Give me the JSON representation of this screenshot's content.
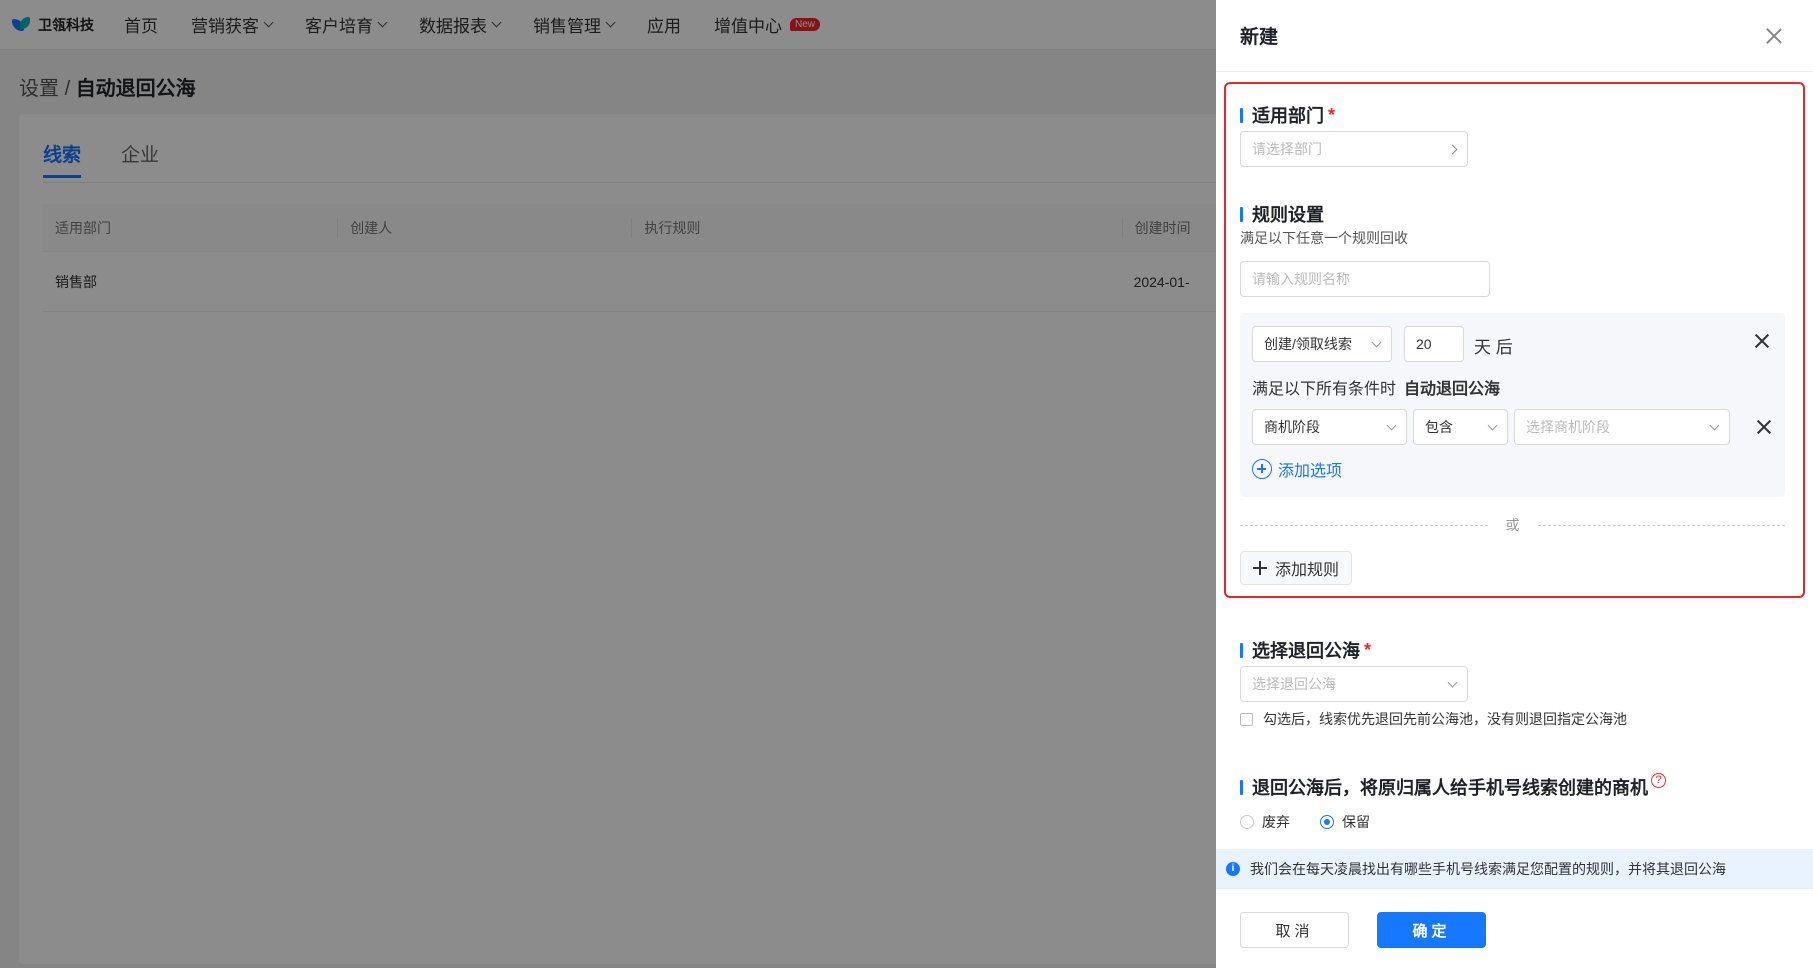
{
  "nav": {
    "logo": "卫瓴科技",
    "items": [
      {
        "label": "首页",
        "dropdown": false
      },
      {
        "label": "营销获客",
        "dropdown": true
      },
      {
        "label": "客户培育",
        "dropdown": true
      },
      {
        "label": "数据报表",
        "dropdown": true
      },
      {
        "label": "销售管理",
        "dropdown": true
      },
      {
        "label": "应用",
        "dropdown": false
      },
      {
        "label": "增值中心",
        "dropdown": false
      }
    ],
    "new_badge": "New"
  },
  "breadcrumb": {
    "parent": "设置",
    "sep": "/",
    "current": "自动退回公海"
  },
  "tabs": [
    "线索",
    "企业"
  ],
  "table": {
    "headers": [
      "适用部门",
      "创建人",
      "执行规则",
      "创建时间"
    ],
    "rows": [
      {
        "dept": "销售部",
        "creator": "",
        "rule": "",
        "time": "2024-01-"
      }
    ]
  },
  "drawer": {
    "title": "新建",
    "dept_section": {
      "title": "适用部门",
      "required": "*",
      "placeholder": "请选择部门"
    },
    "rule_section": {
      "title": "规则设置",
      "desc": "满足以下任意一个规则回收",
      "name_placeholder": "请输入规则名称",
      "trigger_select": "创建/领取线索",
      "days_value": "20",
      "days_unit": "天 后",
      "condition_prefix": "满足以下所有条件时",
      "condition_action": "自动退回公海",
      "field_select": "商机阶段",
      "operator_select": "包含",
      "value_placeholder": "选择商机阶段",
      "add_option": "添加选项",
      "or_text": "或",
      "add_rule": "添加规则"
    },
    "pool_section": {
      "title": "选择退回公海",
      "required": "*",
      "placeholder": "选择退回公海",
      "checkbox_label": "勾选后，线索优先退回先前公海池，没有则退回指定公海池"
    },
    "opportunity_section": {
      "title": "退回公海后，将原归属人给手机号线索创建的商机",
      "help": "?",
      "options": [
        "废弃",
        "保留"
      ],
      "selected": "保留"
    },
    "info": "我们会在每天凌晨找出有哪些手机号线索满足您配置的规则，并将其退回公海",
    "info_icon": "i",
    "cancel": "取消",
    "confirm": "确定"
  },
  "colors": {
    "accent": "#1677ff",
    "highlight": "#e5272e",
    "required": "#f5222d"
  }
}
